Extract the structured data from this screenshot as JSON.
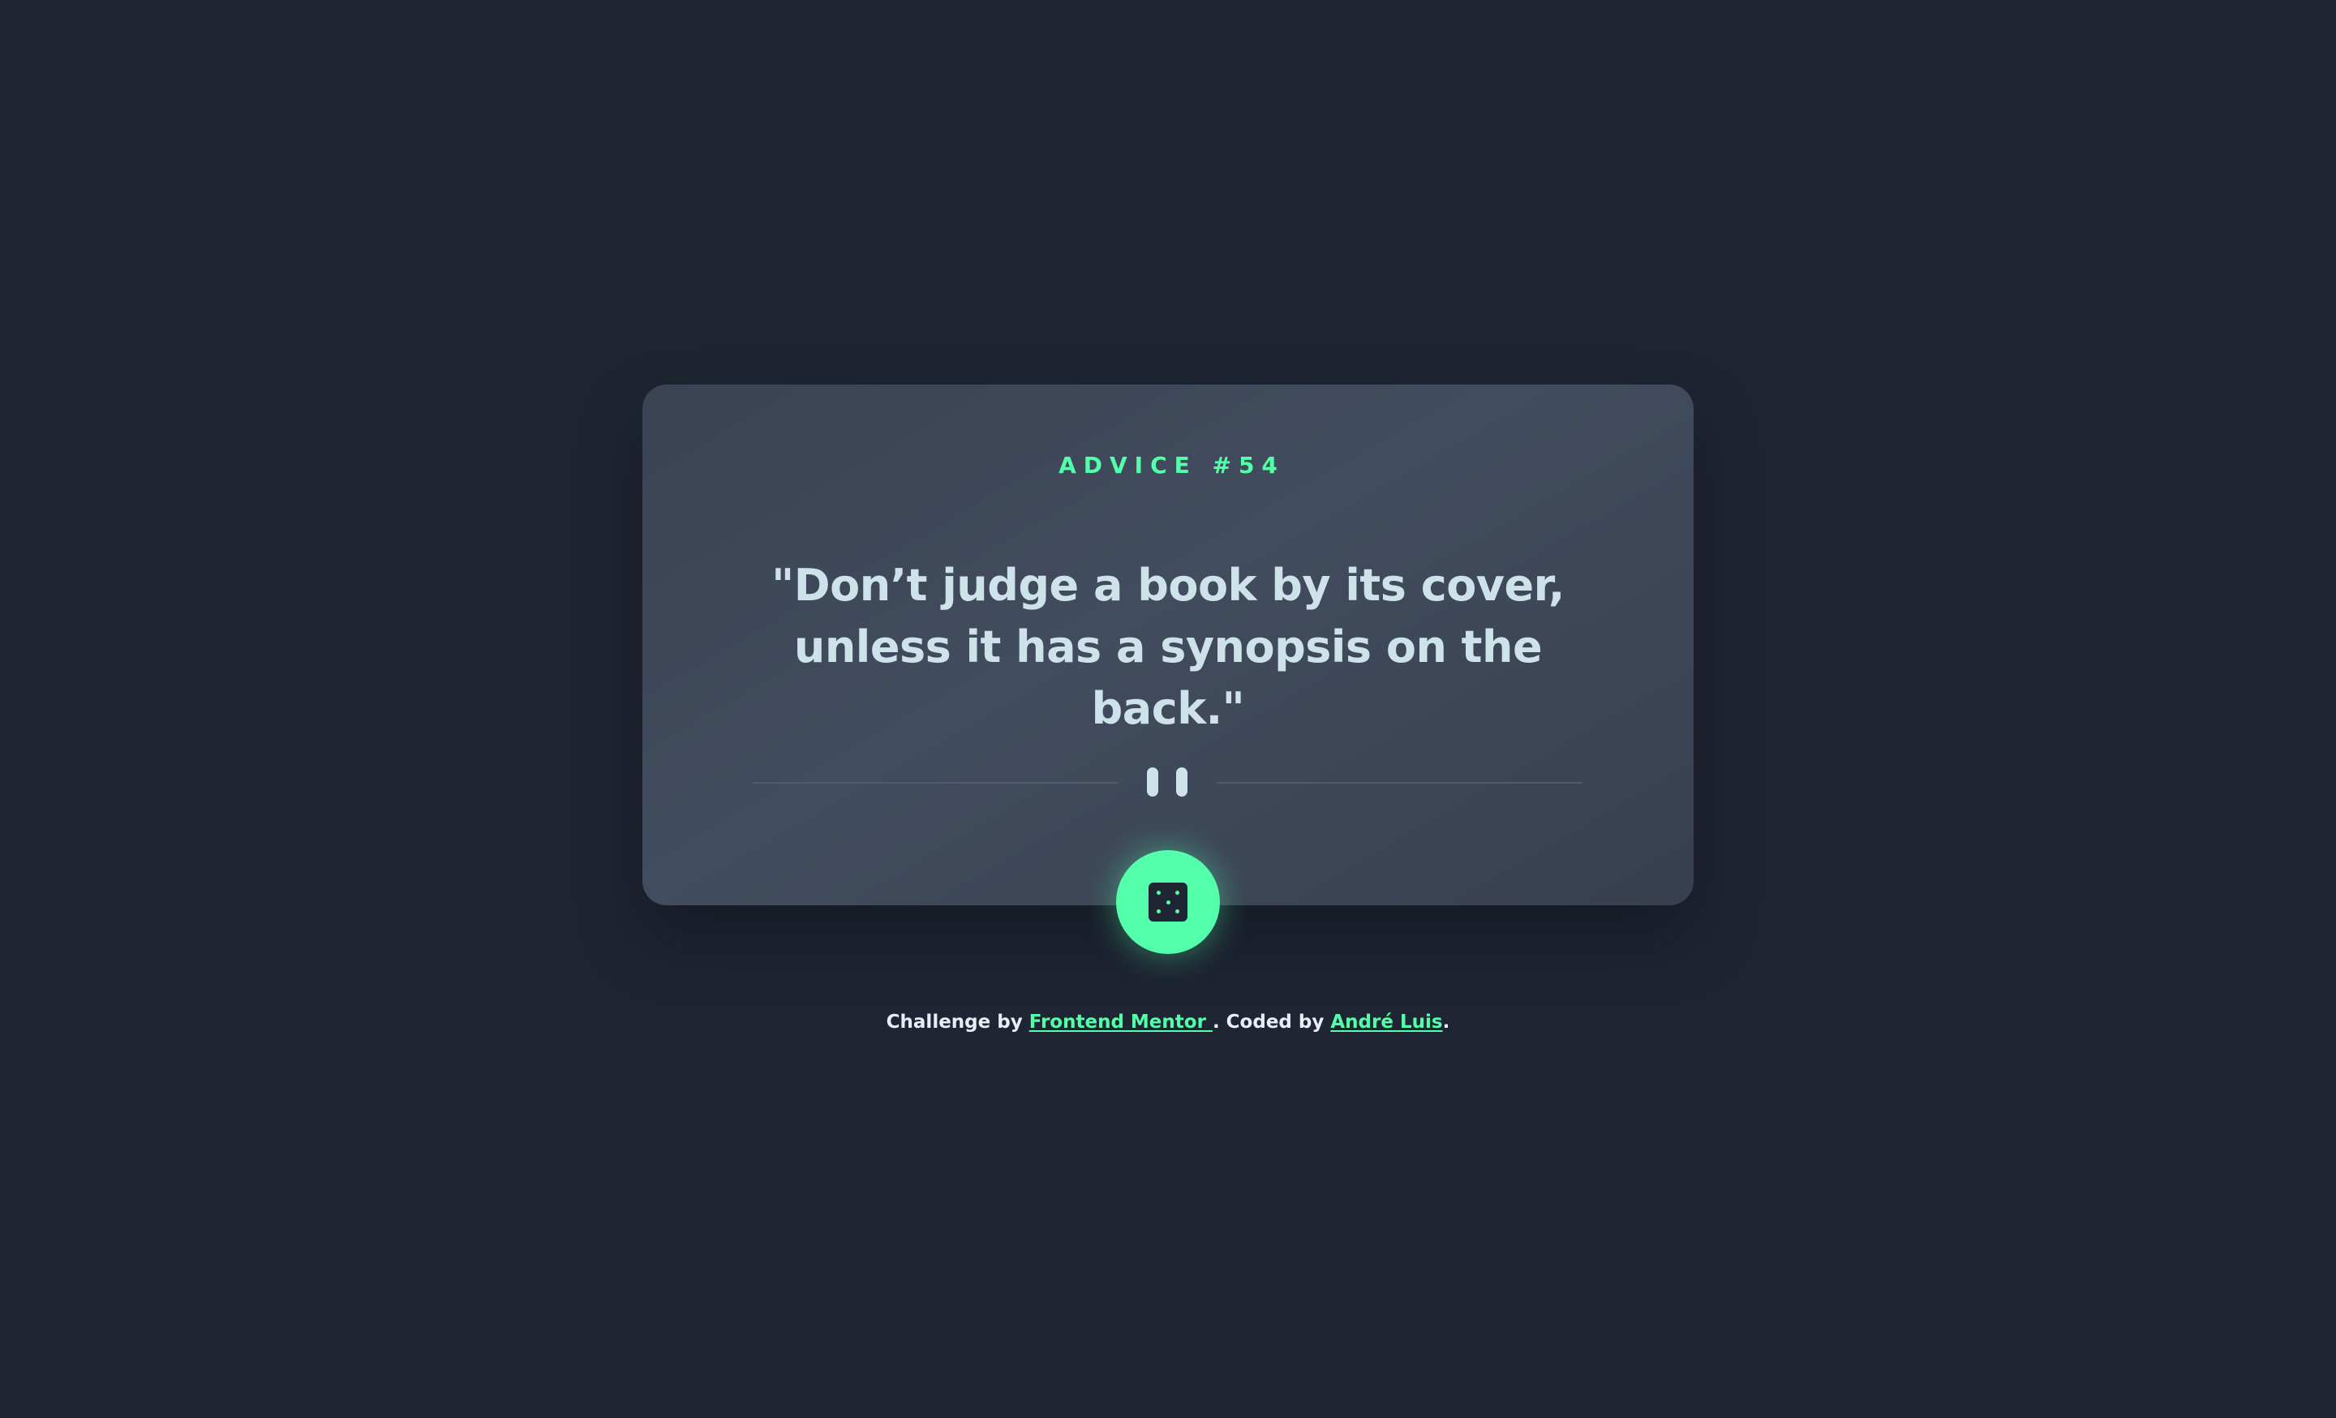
{
  "card": {
    "advice_label": "ADVICE #54",
    "quote": "\"Don’t judge a book by its cover, unless it has a synopsis on the back.\""
  },
  "controls": {
    "divider_icon": "pause-icon",
    "dice_icon": "dice-icon"
  },
  "footer": {
    "prefix": "Challenge by ",
    "link_frontend": "Frontend Mentor ",
    "middle": ". Coded by ",
    "link_author": "André Luis",
    "suffix": "."
  },
  "colors": {
    "background": "#1f2532",
    "card": "#3a4353",
    "accent": "#53ffaa",
    "text": "#cee3e9"
  }
}
